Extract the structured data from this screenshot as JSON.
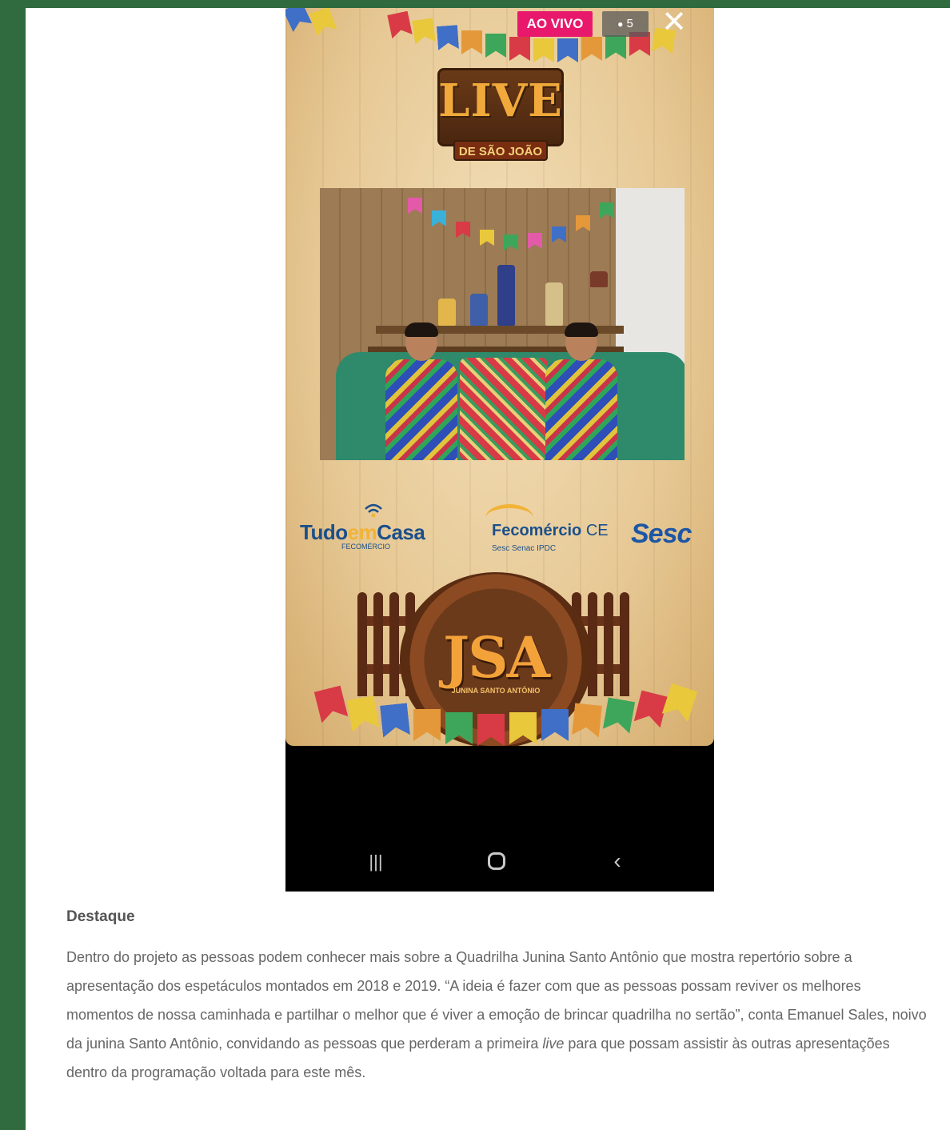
{
  "overlay": {
    "live_badge": "AO VIVO",
    "viewer_count": "5",
    "viewer_icon": "eye-icon",
    "close_icon": "close-icon",
    "close_label": "✕"
  },
  "banner": {
    "title": "LIVE",
    "subtitle": "DE SÃO JOÃO"
  },
  "sponsors": {
    "tudo_em_casa": {
      "part1": "Tudo",
      "part2": "em",
      "part3": "Casa",
      "sub": "FECOMÉRCIO"
    },
    "fecomercio": {
      "name": "Fecomércio",
      "state": "CE",
      "sub": "Sesc  Senac  IPDC"
    },
    "sesc": "Sesc"
  },
  "emblem": {
    "letters": "JSA",
    "name": "JUNINA SANTO ANTÔNIO"
  },
  "navbar": {
    "recents_label": "|||",
    "back_label": "‹",
    "icons": [
      "recents-icon",
      "home-icon",
      "back-icon"
    ]
  },
  "article": {
    "heading": "Destaque",
    "paragraph_part1": "Dentro do projeto as pessoas podem conhecer mais sobre a Quadrilha Junina Santo Antônio que mostra repertório sobre a apresentação dos espetáculos montados em 2018 e 2019. “A ideia é fazer com que as pessoas possam reviver os melhores momentos de nossa caminhada e partilhar o melhor que é viver a emoção de brincar quadrilha no sertão”, conta Emanuel Sales, noivo da junina Santo Antônio, convidando as pessoas que perderam a primeira ",
    "paragraph_em": "live",
    "paragraph_part2": " para que possam assistir às outras apresentações dentro da programação voltada para este mês."
  },
  "colors": {
    "page_border": "#2f6b3f",
    "live_badge": "#e8196c",
    "text": "#666666"
  }
}
